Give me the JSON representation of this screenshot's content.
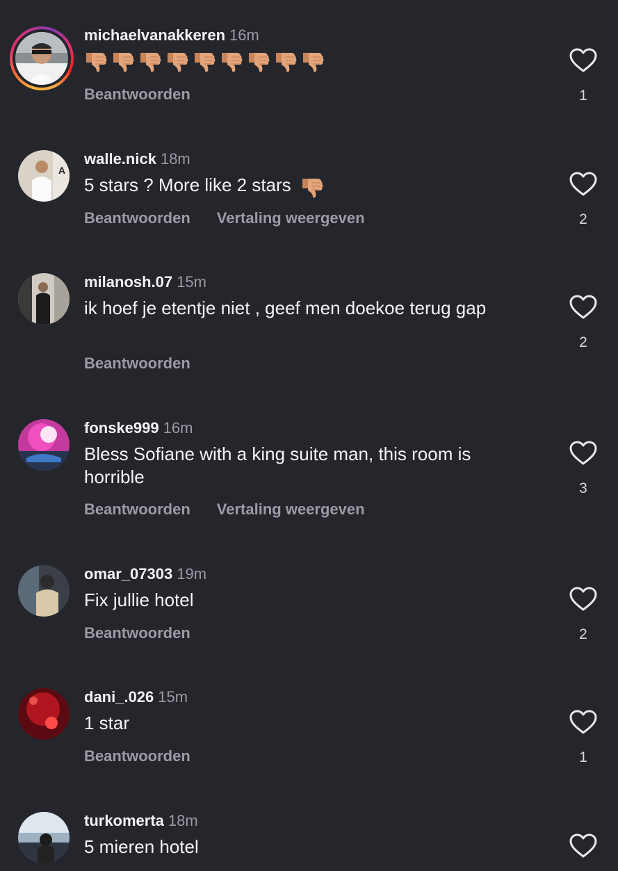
{
  "comments": [
    {
      "username": "michaelvanakkeren",
      "time": "16m",
      "text": "",
      "emoji": "👎",
      "emoji_count": 9,
      "reply_label": "Beantwoorden",
      "translate_label": "",
      "likes": "1",
      "has_story": true
    },
    {
      "username": "walle.nick",
      "time": "18m",
      "text": "5 stars ? More like 2 stars",
      "emoji": "👎",
      "reply_label": "Beantwoorden",
      "translate_label": "Vertaling weergeven",
      "likes": "2",
      "has_story": false
    },
    {
      "username": "milanosh.07",
      "time": "15m",
      "text": "ik hoef je etentje niet , geef men doekoe terug gap",
      "reply_label": "Beantwoorden",
      "translate_label": "",
      "likes": "2",
      "has_story": false
    },
    {
      "username": "fonske999",
      "time": "16m",
      "text": "Bless Sofiane with a king suite man, this room is horrible",
      "reply_label": "Beantwoorden",
      "translate_label": "Vertaling weergeven",
      "likes": "3",
      "has_story": false
    },
    {
      "username": "omar_07303",
      "time": "19m",
      "text": "Fix jullie hotel",
      "reply_label": "Beantwoorden",
      "translate_label": "",
      "likes": "2",
      "has_story": false
    },
    {
      "username": "dani_.026",
      "time": "15m",
      "text": "1 star",
      "reply_label": "Beantwoorden",
      "translate_label": "",
      "likes": "1",
      "has_story": false
    },
    {
      "username": "turkomerta",
      "time": "18m",
      "text": "5 mieren hotel",
      "reply_label": "",
      "translate_label": "",
      "likes": "",
      "has_story": false
    }
  ],
  "icons": {
    "like": "heart-outline-icon",
    "thumb": "thumbs-down-emoji-icon"
  },
  "colors": {
    "background": "#25262c",
    "primary_text": "#f2f2f4",
    "secondary_text": "#9a9ba3",
    "emoji_skin": "#e2a47a"
  }
}
